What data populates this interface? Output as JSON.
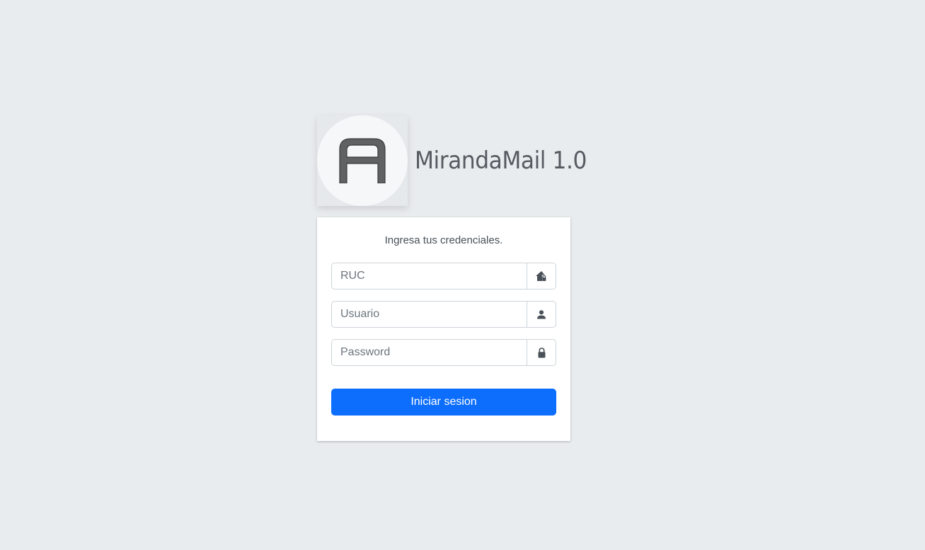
{
  "brand": {
    "title": "MirandaMail 1.0",
    "logo_icon": "letter-a-logo"
  },
  "login": {
    "message": "Ingresa tus credenciales.",
    "fields": {
      "ruc": {
        "placeholder": "RUC",
        "value": "",
        "icon": "house-lock-icon"
      },
      "usuario": {
        "placeholder": "Usuario",
        "value": "",
        "icon": "user-icon"
      },
      "password": {
        "placeholder": "Password",
        "value": "",
        "icon": "lock-icon"
      }
    },
    "submit_label": "Iniciar sesion"
  },
  "colors": {
    "background": "#e9ecef",
    "primary": "#0d6efd",
    "icon": "#495057"
  }
}
